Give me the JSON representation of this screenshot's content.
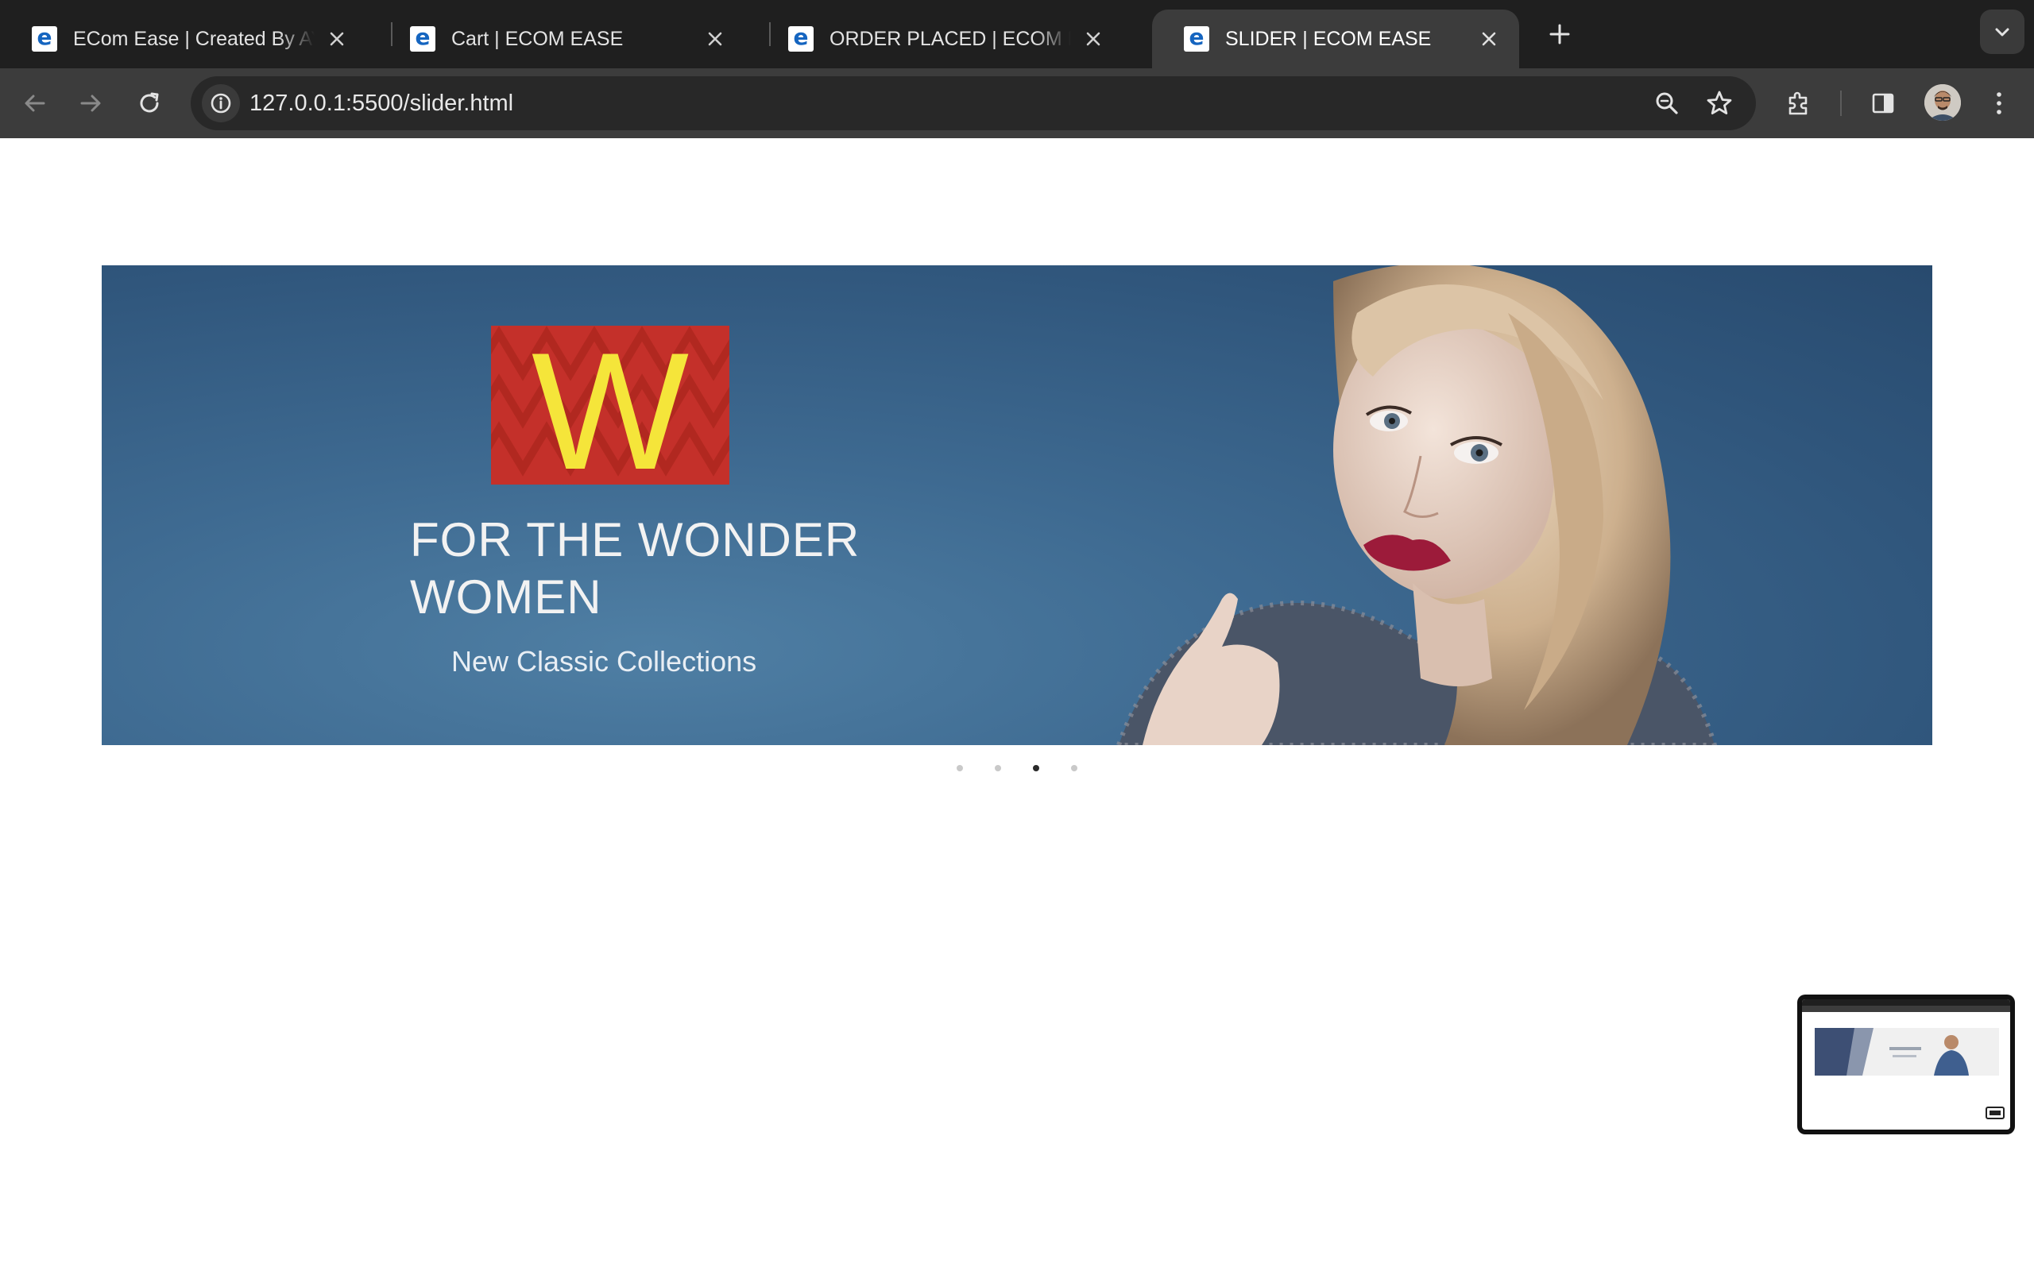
{
  "browser": {
    "tabs": [
      {
        "title": "ECom Ease | Created By AYUSH",
        "favicon": "e",
        "active": false
      },
      {
        "title": "Cart | ECOM EASE",
        "favicon": "e",
        "active": false
      },
      {
        "title": "ORDER PLACED | ECOM EASE",
        "favicon": "e",
        "active": false
      },
      {
        "title": "SLIDER | ECOM EASE",
        "favicon": "e",
        "active": true
      }
    ],
    "address": "127.0.0.1:5500/slider.html",
    "icons": {
      "back": "arrow-left-icon",
      "forward": "arrow-right-icon",
      "reload": "reload-icon",
      "site_info": "info-icon",
      "zoom": "zoom-icon",
      "bookmark": "star-icon",
      "extensions": "puzzle-icon",
      "side_panel": "side-panel-icon",
      "menu": "kebab-menu-icon",
      "new_tab": "plus-icon",
      "tab_search": "chevron-down-icon"
    }
  },
  "slider": {
    "logo_letter": "W",
    "heading": "FOR THE WONDER WOMEN",
    "subheading": "New Classic Collections",
    "slide_count": 4,
    "active_slide": 3
  },
  "colors": {
    "tab_bar": "#1f1f1f",
    "toolbar": "#3c3c3c",
    "slide_bg": "#3e6a91",
    "logo_red": "#c4302a",
    "logo_yellow": "#f5e53a"
  }
}
